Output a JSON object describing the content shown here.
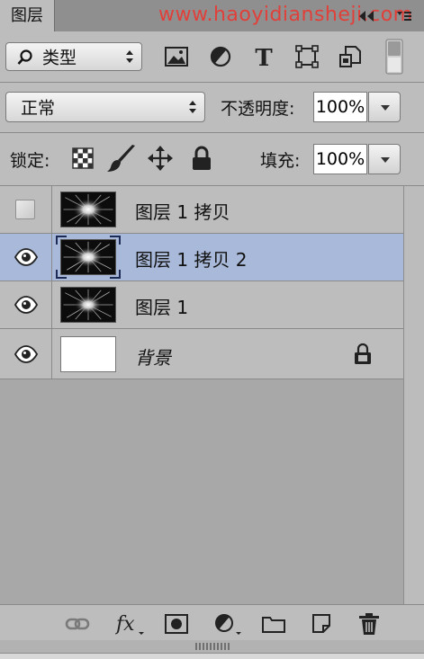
{
  "header": {
    "tab_label": "图层",
    "watermark": "www.haoyidiansheji.com"
  },
  "filter": {
    "kind_label": "类型"
  },
  "blend": {
    "mode": "正常",
    "opacity_label": "不透明度:",
    "opacity_value": "100%"
  },
  "lock": {
    "label": "锁定:",
    "fill_label": "填充:",
    "fill_value": "100%"
  },
  "layers": [
    {
      "name": "图层 1 拷贝",
      "visible": false,
      "selected": false
    },
    {
      "name": "图层 1 拷贝 2",
      "visible": true,
      "selected": true
    },
    {
      "name": "图层 1",
      "visible": true,
      "selected": false
    },
    {
      "name": "背景",
      "visible": true,
      "selected": false,
      "locked": true
    }
  ],
  "colors": {
    "panel": "#bdbdbd",
    "selected_row": "#a9b9d9",
    "watermark": "#e1403a"
  }
}
